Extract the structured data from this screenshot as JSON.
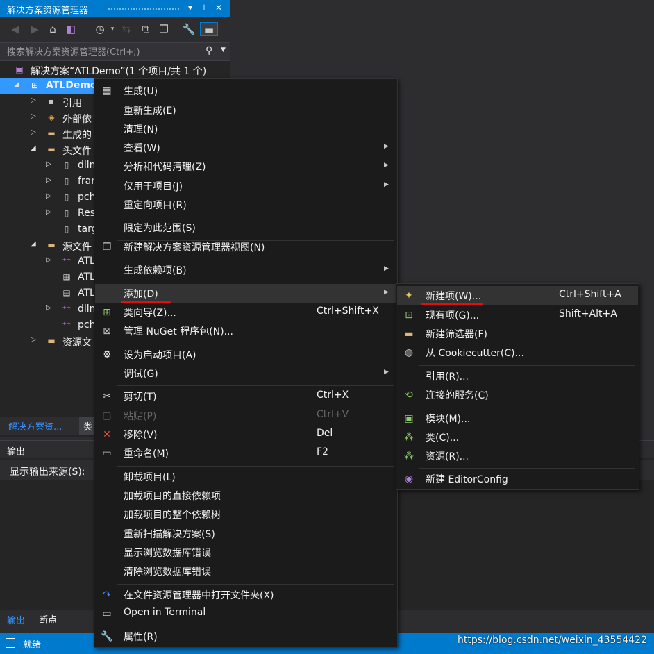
{
  "solution_explorer": {
    "title": "解决方案资源管理器",
    "title_icons": [
      "chevron-down-icon",
      "pin-icon",
      "close-icon"
    ],
    "search_placeholder": "搜索解决方案资源管理器(Ctrl+;)",
    "tree": [
      {
        "label": "解决方案“ATLDemo”(1 个项目/共 1 个)",
        "icon": "solution-icon",
        "indent": 0,
        "arrow": ""
      },
      {
        "label": "ATLDemo",
        "icon": "project-icon",
        "indent": 0,
        "arrow": "◢",
        "selected": true
      },
      {
        "label": "引用",
        "icon": "references-icon",
        "indent": 1,
        "arrow": "▷"
      },
      {
        "label": "外部依",
        "icon": "external-deps-icon",
        "indent": 1,
        "arrow": "▷"
      },
      {
        "label": "生成的",
        "icon": "folder-icon",
        "indent": 1,
        "arrow": "▷"
      },
      {
        "label": "头文件",
        "icon": "folder-icon",
        "indent": 1,
        "arrow": "◢"
      },
      {
        "label": "dllm",
        "icon": "header-file-icon",
        "indent": 2,
        "arrow": "▷"
      },
      {
        "label": "fram",
        "icon": "header-file-icon",
        "indent": 2,
        "arrow": "▷"
      },
      {
        "label": "pch.",
        "icon": "header-file-icon",
        "indent": 2,
        "arrow": "▷"
      },
      {
        "label": "Reso",
        "icon": "header-file-icon",
        "indent": 2,
        "arrow": "▷"
      },
      {
        "label": "targ",
        "icon": "header-file-icon",
        "indent": 2,
        "arrow": ""
      },
      {
        "label": "源文件",
        "icon": "folder-icon",
        "indent": 1,
        "arrow": "◢"
      },
      {
        "label": "ATL",
        "icon": "cpp-file-icon",
        "indent": 2,
        "arrow": "▷"
      },
      {
        "label": "ATL",
        "icon": "idl-file-icon",
        "indent": 2,
        "arrow": ""
      },
      {
        "label": "ATL",
        "icon": "def-file-icon",
        "indent": 2,
        "arrow": ""
      },
      {
        "label": "dllm",
        "icon": "cpp-file-icon",
        "indent": 2,
        "arrow": "▷"
      },
      {
        "label": "pch.",
        "icon": "cpp-file-icon",
        "indent": 2,
        "arrow": ""
      },
      {
        "label": "资源文",
        "icon": "folder-icon",
        "indent": 1,
        "arrow": "▷"
      }
    ],
    "bottom_tabs": [
      "解决方案资...",
      "类"
    ]
  },
  "output": {
    "title": "输出",
    "source_label": "显示输出来源(S):",
    "tabs": [
      "输出",
      "断点"
    ]
  },
  "status_bar": {
    "text": "就绪",
    "watermark": "https://blog.csdn.net/weixin_43554422"
  },
  "context_menu": {
    "groups": [
      [
        {
          "label": "生成(U)",
          "icon": "build-icon"
        },
        {
          "label": "重新生成(E)",
          "icon": ""
        },
        {
          "label": "清理(N)",
          "icon": ""
        },
        {
          "label": "查看(W)",
          "icon": "",
          "submenu": true
        },
        {
          "label": "分析和代码清理(Z)",
          "icon": "",
          "submenu": true
        },
        {
          "label": "仅用于项目(J)",
          "icon": "",
          "submenu": true
        },
        {
          "label": "重定向项目(R)",
          "icon": ""
        }
      ],
      [
        {
          "label": "限定为此范围(S)",
          "icon": ""
        },
        {
          "label": "新建解决方案资源管理器视图(N)",
          "icon": "new-view-icon"
        }
      ],
      [
        {
          "label": "生成依赖项(B)",
          "icon": "",
          "submenu": true
        }
      ],
      [
        {
          "label": "添加(D)",
          "icon": "",
          "submenu": true,
          "highlighted": true
        },
        {
          "label": "类向导(Z)...",
          "icon": "class-wizard-icon",
          "shortcut": "Ctrl+Shift+X"
        },
        {
          "label": "管理 NuGet 程序包(N)...",
          "icon": "nuget-icon"
        }
      ],
      [
        {
          "label": "设为启动项目(A)",
          "icon": "gear-icon"
        },
        {
          "label": "调试(G)",
          "icon": "",
          "submenu": true
        }
      ],
      [
        {
          "label": "剪切(T)",
          "icon": "scissors-icon",
          "shortcut": "Ctrl+X"
        },
        {
          "label": "粘贴(P)",
          "icon": "paste-icon",
          "shortcut": "Ctrl+V",
          "disabled": true
        },
        {
          "label": "移除(V)",
          "icon": "remove-x-icon",
          "shortcut": "Del"
        },
        {
          "label": "重命名(M)",
          "icon": "rename-icon",
          "shortcut": "F2"
        }
      ],
      [
        {
          "label": "卸载项目(L)",
          "icon": ""
        },
        {
          "label": "加载项目的直接依赖项",
          "icon": ""
        },
        {
          "label": "加载项目的整个依赖树",
          "icon": ""
        },
        {
          "label": "重新扫描解决方案(S)",
          "icon": ""
        },
        {
          "label": "显示浏览数据库错误",
          "icon": ""
        },
        {
          "label": "清除浏览数据库错误",
          "icon": ""
        }
      ],
      [
        {
          "label": "在文件资源管理器中打开文件夹(X)",
          "icon": "open-folder-arrow-icon"
        },
        {
          "label": "Open in Terminal",
          "icon": "terminal-icon"
        }
      ],
      [
        {
          "label": "属性(R)",
          "icon": "wrench-icon"
        }
      ]
    ]
  },
  "add_submenu": {
    "groups": [
      [
        {
          "label": "新建项(W)...",
          "icon": "new-item-icon",
          "shortcut": "Ctrl+Shift+A",
          "highlighted": true
        },
        {
          "label": "现有项(G)...",
          "icon": "existing-item-icon",
          "shortcut": "Shift+Alt+A"
        },
        {
          "label": "新建筛选器(F)",
          "icon": "new-filter-folder-icon"
        },
        {
          "label": "从 Cookiecutter(C)...",
          "icon": "cookiecutter-icon"
        }
      ],
      [
        {
          "label": "引用(R)...",
          "icon": ""
        },
        {
          "label": "连接的服务(C)",
          "icon": "connected-service-icon"
        }
      ],
      [
        {
          "label": "模块(M)...",
          "icon": "module-icon"
        },
        {
          "label": "类(C)...",
          "icon": "class-icon"
        },
        {
          "label": "资源(R)...",
          "icon": "resource-icon"
        }
      ],
      [
        {
          "label": "新建 EditorConfig",
          "icon": "editorconfig-bulb-icon"
        }
      ]
    ]
  },
  "colors": {
    "accent": "#007acc",
    "selection": "#3399ff",
    "menu_bg": "#1b1b1c",
    "menu_highlight": "#333334",
    "annotation_red": "#e01010"
  }
}
